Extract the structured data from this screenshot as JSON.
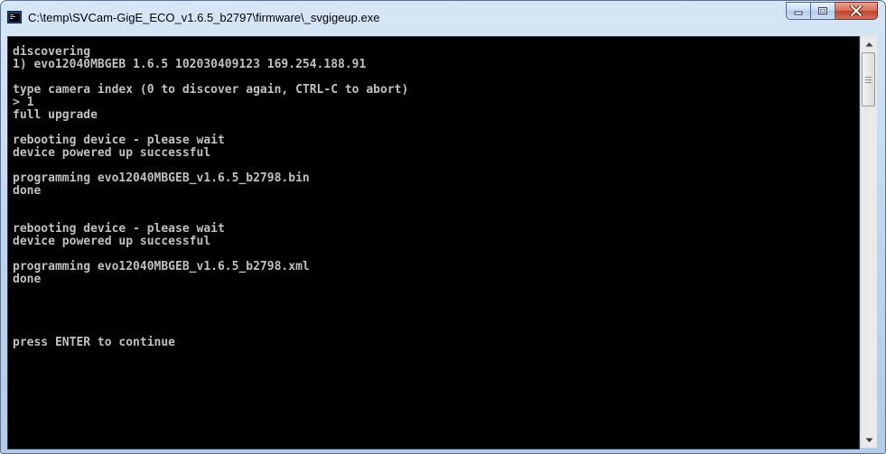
{
  "window": {
    "title": "C:\\temp\\SVCam-GigE_ECO_v1.6.5_b2797\\firmware\\_svgigeup.exe",
    "icon": "console-app-icon",
    "controls": [
      "minimize-icon",
      "maximize-icon",
      "close-icon"
    ],
    "accent_close": "#c3422a"
  },
  "console": {
    "background": "#000000",
    "foreground": "#c0c0c0",
    "lines": [
      "discovering",
      "1) evo12040MBGEB 1.6.5 102030409123 169.254.188.91",
      "",
      "type camera index (0 to discover again, CTRL-C to abort)",
      "> 1",
      "full upgrade",
      "",
      "rebooting device - please wait",
      "device powered up successful",
      "",
      "programming evo12040MBGEB_v1.6.5_b2798.bin",
      "done",
      "",
      "",
      "rebooting device - please wait",
      "device powered up successful",
      "",
      "programming evo12040MBGEB_v1.6.5_b2798.xml",
      "done",
      "",
      "",
      "",
      "",
      "press ENTER to continue"
    ]
  },
  "scrollbar": {
    "up_icon": "scroll-up-arrow-icon",
    "down_icon": "scroll-down-arrow-icon",
    "position": 0.0
  }
}
